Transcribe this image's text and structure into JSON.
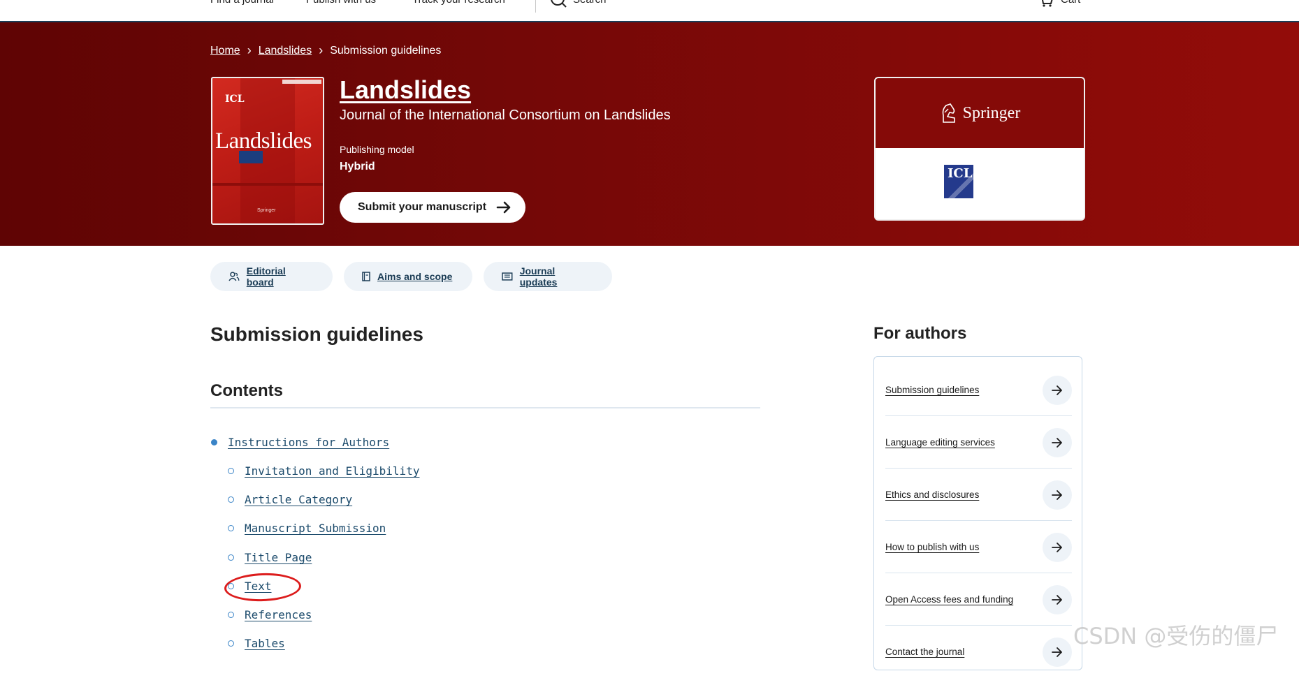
{
  "topnav": {
    "find_journal": "Find a journal",
    "publish": "Publish with us",
    "track": "Track your research",
    "search": "Search",
    "cart": "Cart"
  },
  "breadcrumb": {
    "home": "Home",
    "journal": "Landslides",
    "current": "Submission guidelines"
  },
  "journal": {
    "title": "Landslides",
    "subtitle": "Journal of the International Consortium on Landslides",
    "publishing_model_label": "Publishing model",
    "publishing_model_value": "Hybrid",
    "submit_label": "Submit your manuscript",
    "cover_title": "Landslides",
    "cover_logo": "ICL",
    "cover_publisher": "Springer"
  },
  "publisher": {
    "name": "Springer",
    "partner_logo": "ICL"
  },
  "pills": [
    {
      "label": "Editorial board",
      "icon": "people-icon"
    },
    {
      "label": "Aims and scope",
      "icon": "book-icon"
    },
    {
      "label": "Journal updates",
      "icon": "newspaper-icon"
    }
  ],
  "main": {
    "heading": "Submission guidelines",
    "contents_heading": "Contents",
    "toc": [
      {
        "label": "Instructions for Authors",
        "level": 1
      },
      {
        "label": "Invitation and Eligibility",
        "level": 2
      },
      {
        "label": "Article Category",
        "level": 2
      },
      {
        "label": "Manuscript Submission",
        "level": 2
      },
      {
        "label": "Title Page",
        "level": 2
      },
      {
        "label": "Text",
        "level": 2
      },
      {
        "label": "References",
        "level": 2
      },
      {
        "label": "Tables",
        "level": 2
      }
    ]
  },
  "sidebar": {
    "heading": "For authors",
    "links": [
      "Submission guidelines",
      "Language editing services",
      "Ethics and disclosures",
      "How to publish with us",
      "Open Access fees and funding",
      "Contact the journal"
    ]
  },
  "watermark": "CSDN @受伤的僵尸",
  "colors": {
    "hero_start": "#5f0404",
    "hero_end": "#930c09",
    "link_blue": "#1b4a6b",
    "bullet": "#3a84c7",
    "annotation_red": "#dc1c1c"
  }
}
